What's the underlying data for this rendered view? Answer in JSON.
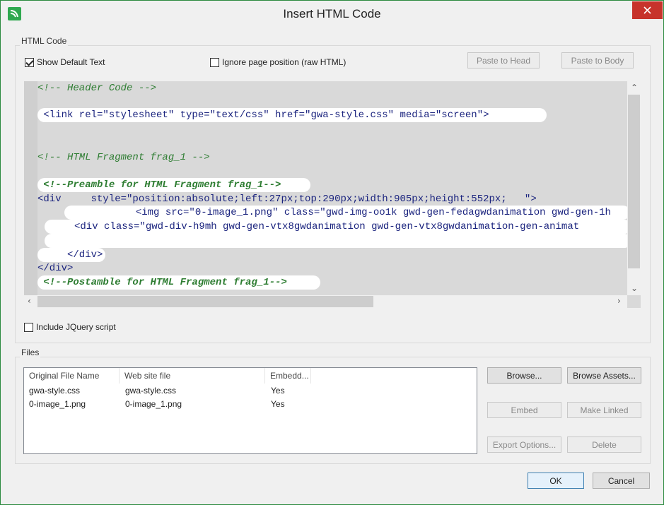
{
  "window": {
    "title": "Insert HTML Code",
    "close_glyph": "✕"
  },
  "html_code_group": {
    "label": "HTML Code",
    "show_default_text": {
      "label": "Show Default Text",
      "checked": true
    },
    "ignore_page_position": {
      "label": "Ignore page position (raw HTML)",
      "checked": false
    },
    "paste_to_head": "Paste to Head",
    "paste_to_body": "Paste to Body"
  },
  "code_lines": [
    "<!-- Header Code -->",
    "",
    " <link rel=\"stylesheet\" type=\"text/css\" href=\"gwa-style.css\" media=\"screen\">",
    "",
    "",
    "<!-- HTML Fragment frag_1 -->",
    "",
    " <!--Preamble for HTML Fragment frag_1-->",
    "<div     style=\"position:absolute;left:27px;top:290px;width:905px;height:552px;   \">",
    "            <img src=\"0-image_1.png\" class=\"gwd-img-oo1k gwd-gen-fedagwdanimation gwd-gen-1h",
    "     <div class=\"gwd-div-h9mh gwd-gen-vtx8gwdanimation gwd-gen-vtx8gwdanimation-gen-animat",
    "",
    "     </div>",
    "</div>",
    " <!--Postamble for HTML Fragment frag_1-->"
  ],
  "include_jquery": {
    "label": "Include JQuery script",
    "checked": false
  },
  "files_group": {
    "label": "Files",
    "columns": [
      "Original File Name",
      "Web site file",
      "Embedd..."
    ],
    "rows": [
      [
        "gwa-style.css",
        "gwa-style.css",
        "Yes"
      ],
      [
        "0-image_1.png",
        "0-image_1.png",
        "Yes"
      ]
    ],
    "browse": "Browse...",
    "browse_assets": "Browse Assets...",
    "embed": "Embed",
    "make_linked": "Make Linked",
    "export_options": "Export Options...",
    "delete": "Delete"
  },
  "dialog_buttons": {
    "ok": "OK",
    "cancel": "Cancel"
  },
  "colors": {
    "accent_green": "#2fa84f",
    "close_red": "#c7332b",
    "comment_green": "#2e7d32"
  }
}
